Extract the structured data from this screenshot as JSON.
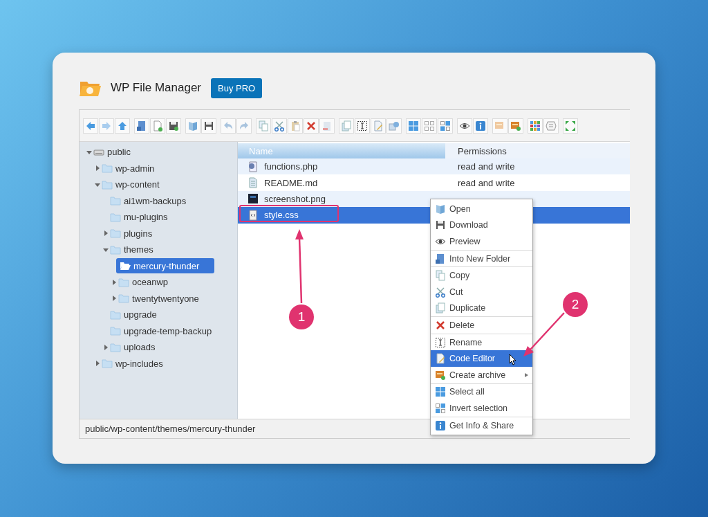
{
  "header": {
    "title": "WP File Manager",
    "button": "Buy PRO"
  },
  "tree": [
    {
      "label": "public",
      "kind": "drive",
      "expanded": true,
      "selected": false,
      "children": [
        {
          "label": "wp-admin",
          "kind": "folder",
          "expanded": false,
          "selected": false
        },
        {
          "label": "wp-content",
          "kind": "folder",
          "expanded": true,
          "selected": false,
          "children": [
            {
              "label": "ai1wm-backups",
              "kind": "folder",
              "selected": false
            },
            {
              "label": "mu-plugins",
              "kind": "folder",
              "selected": false
            },
            {
              "label": "plugins",
              "kind": "folder",
              "expanded": false,
              "selected": false
            },
            {
              "label": "themes",
              "kind": "folder",
              "expanded": true,
              "selected": false,
              "children": [
                {
                  "label": "mercury-thunder",
                  "kind": "folder",
                  "selected": true
                },
                {
                  "label": "oceanwp",
                  "kind": "folder",
                  "expanded": false,
                  "selected": false
                },
                {
                  "label": "twentytwentyone",
                  "kind": "folder",
                  "expanded": false,
                  "selected": false
                }
              ]
            },
            {
              "label": "upgrade",
              "kind": "folder",
              "selected": false
            },
            {
              "label": "upgrade-temp-backup",
              "kind": "folder",
              "selected": false
            },
            {
              "label": "uploads",
              "kind": "folder",
              "expanded": false,
              "selected": false
            }
          ]
        },
        {
          "label": "wp-includes",
          "kind": "folder",
          "expanded": false,
          "selected": false
        }
      ]
    }
  ],
  "table": {
    "columns": [
      "Name",
      "Permissions"
    ],
    "rows": [
      {
        "name": "functions.php",
        "kind": "script",
        "permissions": "read and write",
        "selected": false
      },
      {
        "name": "README.md",
        "kind": "text",
        "permissions": "read and write",
        "selected": false
      },
      {
        "name": "screenshot.png",
        "kind": "image",
        "selected": false
      },
      {
        "name": "style.css",
        "kind": "code",
        "selected": true
      }
    ]
  },
  "context_menu": {
    "groups": [
      [
        {
          "label": "Open",
          "kind": "open",
          "selected": false,
          "submenu": false
        },
        {
          "label": "Download",
          "kind": "save",
          "selected": false,
          "submenu": false
        },
        {
          "label": "Preview",
          "kind": "eye",
          "selected": false,
          "submenu": false
        }
      ],
      [
        {
          "label": "Into New Folder",
          "kind": "newfolder",
          "selected": false,
          "submenu": false
        }
      ],
      [
        {
          "label": "Copy",
          "kind": "copy",
          "selected": false,
          "submenu": false
        },
        {
          "label": "Cut",
          "kind": "cut",
          "selected": false,
          "submenu": false
        },
        {
          "label": "Duplicate",
          "kind": "duplicate",
          "selected": false,
          "submenu": false
        }
      ],
      [
        {
          "label": "Delete",
          "kind": "delete",
          "selected": false,
          "submenu": false
        }
      ],
      [
        {
          "label": "Rename",
          "kind": "rename",
          "selected": false,
          "submenu": false
        },
        {
          "label": "Code Editor",
          "kind": "edit",
          "selected": true,
          "submenu": false
        },
        {
          "label": "Create archive",
          "kind": "archive",
          "selected": false,
          "submenu": true
        }
      ],
      [
        {
          "label": "Select all",
          "kind": "grid",
          "selected": false,
          "submenu": false
        },
        {
          "label": "Invert selection",
          "kind": "invert",
          "selected": false,
          "submenu": false
        }
      ],
      [
        {
          "label": "Get Info & Share",
          "kind": "info",
          "selected": false,
          "submenu": false
        }
      ]
    ]
  },
  "status_bar": {
    "path": "public/wp-content/themes/mercury-thunder"
  },
  "callouts": [
    {
      "number": "1"
    },
    {
      "number": "2"
    }
  ]
}
